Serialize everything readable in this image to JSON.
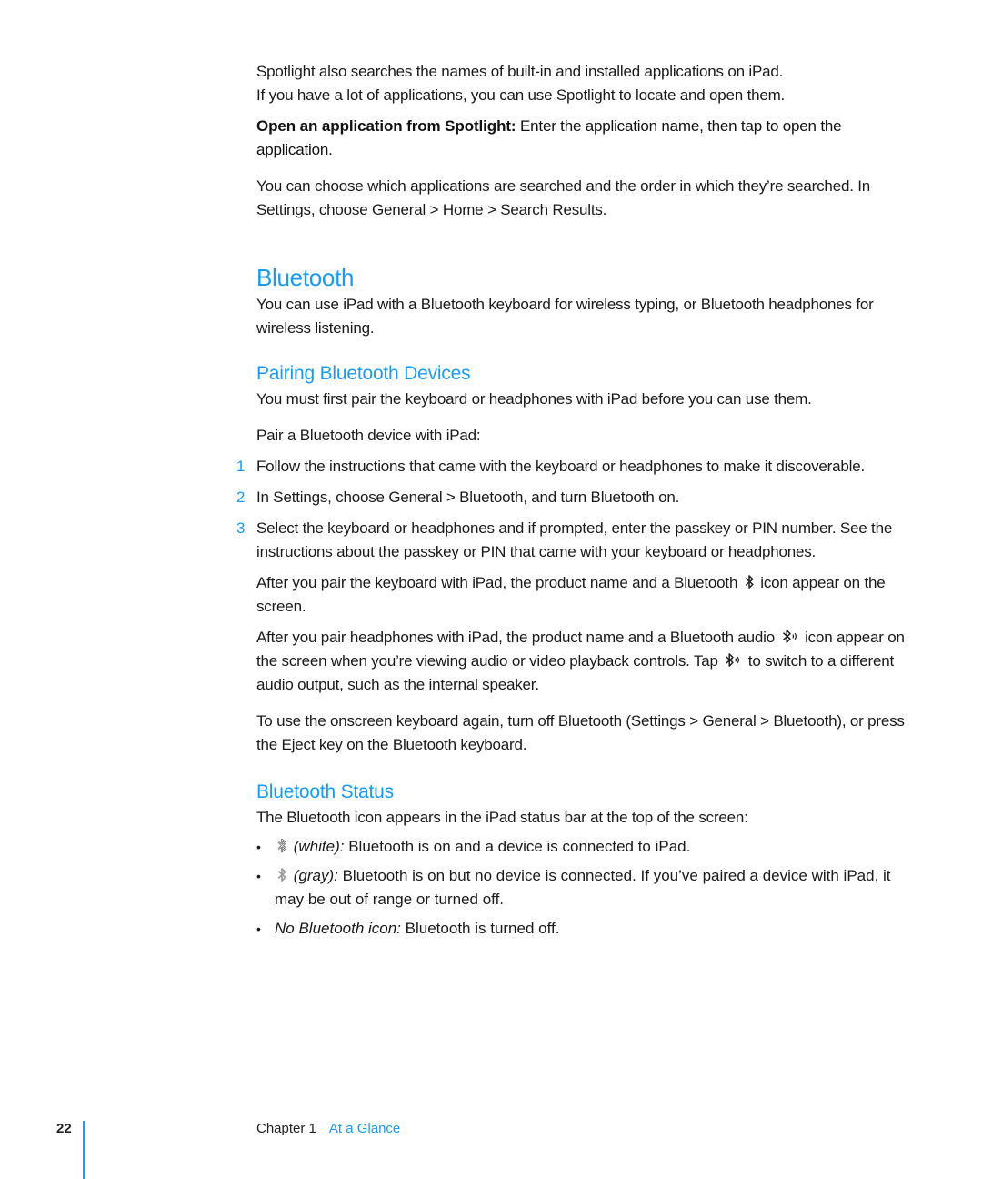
{
  "intro": {
    "p1_line1": "Spotlight also searches the names of built-in and installed applications on iPad.",
    "p1_line2": "If you have a lot of applications, you can use Spotlight to locate and open them.",
    "task_label": "Open an application from Spotlight:",
    "task_text": "Enter the application name, then tap to open the application.",
    "p3": "You can choose which applications are searched and the order in which they’re searched. In Settings, choose General > Home > Search Results."
  },
  "bluetooth": {
    "heading": "Bluetooth",
    "intro": "You can use iPad with a Bluetooth keyboard for wireless typing, or Bluetooth headphones for wireless listening."
  },
  "pairing": {
    "heading": "Pairing Bluetooth Devices",
    "intro": "You must first pair the keyboard or headphones with iPad before you can use them.",
    "task_label": "Pair a Bluetooth device with iPad:",
    "steps": [
      {
        "num": "1",
        "text": "Follow the instructions that came with the keyboard or headphones to make it discoverable."
      },
      {
        "num": "2",
        "text": "In Settings, choose General > Bluetooth, and turn Bluetooth on."
      },
      {
        "num": "3",
        "text": "Select the keyboard or headphones and if prompted, enter the passkey or PIN number. See the instructions about the passkey or PIN that came with your keyboard or headphones."
      }
    ],
    "keyboard_note_a": "After you pair the keyboard with iPad, the product name and a Bluetooth",
    "keyboard_note_b": "icon appear on the screen.",
    "headphones_note_a": "After you pair headphones with iPad, the product name and a Bluetooth audio",
    "headphones_note_b": "icon appear on the screen when you’re viewing audio or video playback controls. Tap",
    "headphones_note_c": "to switch to a different audio output, such as the internal speaker.",
    "onscreen_note": "To use the onscreen keyboard again, turn off Bluetooth (Settings > General > Bluetooth), or press the Eject key on the Bluetooth keyboard."
  },
  "status": {
    "heading": "Bluetooth Status",
    "intro": "The Bluetooth icon appears in the iPad status bar at the top of the screen:",
    "items": [
      {
        "icon": "bluetooth-white-icon",
        "label": "(white):",
        "text": "Bluetooth is on and a device is connected to iPad."
      },
      {
        "icon": "bluetooth-gray-icon",
        "label": "(gray):",
        "text": "Bluetooth is on but no device is connected. If you’ve paired a device with iPad, it may be out of range or turned off."
      },
      {
        "icon": "",
        "label": "No Bluetooth icon:",
        "text": "Bluetooth is turned off."
      }
    ]
  },
  "footer": {
    "page_number": "22",
    "chapter": "Chapter 1",
    "chapter_title": "At a Glance"
  },
  "colors": {
    "accent": "#1a9bf0",
    "text": "#1a1a1a",
    "icon_white": "#555555",
    "icon_gray": "#9a9a9a"
  }
}
